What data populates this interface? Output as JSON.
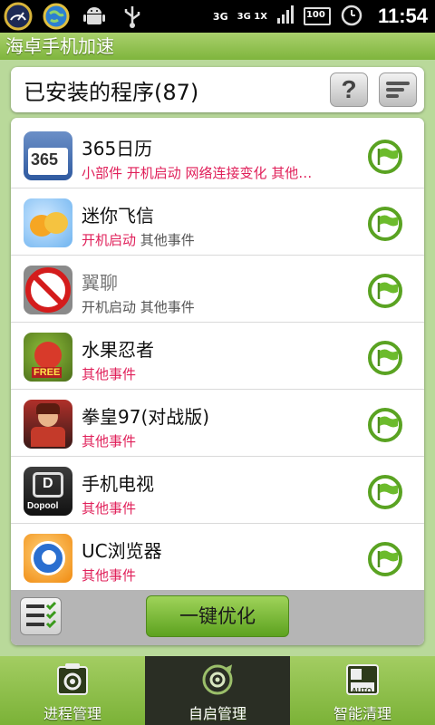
{
  "status_bar": {
    "network_3g": "3G",
    "network_3g_1x": "3G 1X",
    "battery": "100",
    "time": "11:54",
    "icons": [
      "speedometer-icon",
      "globe-icon",
      "android-icon",
      "usb-icon",
      "signal-icon",
      "battery-icon",
      "alarm-icon"
    ]
  },
  "app": {
    "title": "海卓手机加速"
  },
  "header": {
    "title": "已安装的程序(87)",
    "help_label": "?"
  },
  "apps": [
    {
      "name": "365日历",
      "events_red": "小部件 开机启动 网络连接变化 其他…",
      "events_gray": "",
      "icon": "calendar-365-icon",
      "name_gray": false
    },
    {
      "name": "迷你飞信",
      "events_red": "开机启动",
      "events_gray": " 其他事件",
      "icon": "fetion-icon",
      "name_gray": false
    },
    {
      "name": "翼聊",
      "events_red": "",
      "events_gray": "开机启动 其他事件",
      "icon": "yiliao-disabled-icon",
      "name_gray": true
    },
    {
      "name": "水果忍者",
      "events_red": "其他事件",
      "events_gray": "",
      "icon": "fruit-ninja-icon",
      "name_gray": false
    },
    {
      "name": "拳皇97(对战版)",
      "events_red": "其他事件",
      "events_gray": "",
      "icon": "kof97-icon",
      "name_gray": false
    },
    {
      "name": "手机电视",
      "events_red": "其他事件",
      "events_gray": "",
      "icon": "dopool-tv-icon",
      "name_gray": false
    },
    {
      "name": "UC浏览器",
      "events_red": "其他事件",
      "events_gray": "",
      "icon": "uc-browser-icon",
      "name_gray": false
    }
  ],
  "icon_texts": {
    "calendar": "365",
    "fruit_free": "FREE",
    "dopool": "Dopool",
    "dopool_d": "D",
    "auto": "AUTO"
  },
  "action": {
    "optimize_label": "一键优化"
  },
  "tabs": [
    {
      "label": "进程管理",
      "icon": "process-gear-icon",
      "active": false
    },
    {
      "label": "自启管理",
      "icon": "autostart-gear-icon",
      "active": true
    },
    {
      "label": "智能清理",
      "icon": "auto-clean-icon",
      "active": false
    }
  ],
  "colors": {
    "accent_green": "#7fb53d",
    "event_red": "#e0205a",
    "active_tab": "#2a2e24"
  }
}
